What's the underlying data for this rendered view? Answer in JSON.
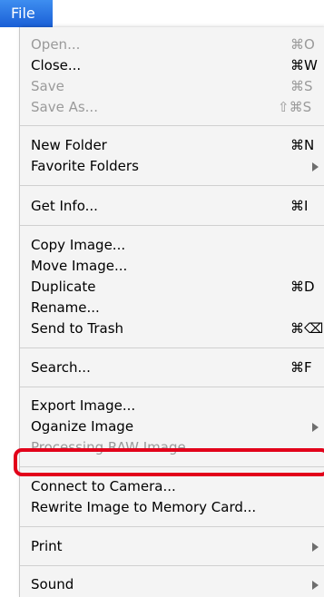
{
  "menubar": {
    "title": "File"
  },
  "menu": {
    "items": [
      {
        "label": "Open...",
        "shortcut": "⌘O",
        "enabled": false
      },
      {
        "label": "Close...",
        "shortcut": "⌘W",
        "enabled": true
      },
      {
        "label": "Save",
        "shortcut": "⌘S",
        "enabled": false
      },
      {
        "label": "Save As...",
        "shortcut": "⇧⌘S",
        "enabled": false
      },
      {
        "label": "New Folder",
        "shortcut": "⌘N",
        "enabled": true
      },
      {
        "label": "Favorite Folders",
        "submenu": true,
        "enabled": true
      },
      {
        "label": "Get Info...",
        "shortcut": "⌘I",
        "enabled": true
      },
      {
        "label": "Copy Image...",
        "enabled": true
      },
      {
        "label": "Move Image...",
        "enabled": true
      },
      {
        "label": "Duplicate",
        "shortcut": "⌘D",
        "enabled": true
      },
      {
        "label": "Rename...",
        "enabled": true
      },
      {
        "label": "Send to Trash",
        "shortcut": "⌘⌫",
        "enabled": true
      },
      {
        "label": "Search...",
        "shortcut": "⌘F",
        "enabled": true
      },
      {
        "label": "Export Image...",
        "enabled": true,
        "highlighted_by_annotation": true
      },
      {
        "label": "Oganize Image",
        "submenu": true,
        "enabled": true
      },
      {
        "label": "Processing RAW Image...",
        "enabled": false
      },
      {
        "label": "Connect to Camera...",
        "enabled": true
      },
      {
        "label": "Rewrite Image to Memory Card...",
        "enabled": true
      },
      {
        "label": "Print",
        "submenu": true,
        "enabled": true
      },
      {
        "label": "Sound",
        "submenu": true,
        "enabled": true
      }
    ]
  },
  "colors": {
    "menu_title_bg": "#2a73e4",
    "disabled_text": "#9a9a9a",
    "annotation_outline": "#e2001a"
  }
}
